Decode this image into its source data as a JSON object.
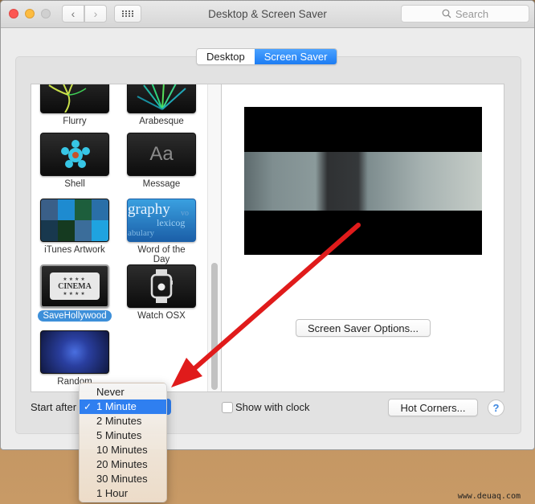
{
  "window": {
    "title": "Desktop & Screen Saver",
    "search_placeholder": "Search"
  },
  "tabs": [
    {
      "label": "Desktop",
      "active": false
    },
    {
      "label": "Screen Saver",
      "active": true
    }
  ],
  "savers": [
    {
      "label": "Flurry",
      "icon": "flurry-thumbnail"
    },
    {
      "label": "Arabesque",
      "icon": "arabesque-thumbnail"
    },
    {
      "label": "Shell",
      "icon": "shell-thumbnail"
    },
    {
      "label": "Message",
      "icon": "message-thumbnail",
      "glyph": "Aa"
    },
    {
      "label": "iTunes Artwork",
      "icon": "itunes-artwork-thumbnail"
    },
    {
      "label": "Word of the Day",
      "icon": "word-of-the-day-thumbnail",
      "words": [
        "graphy",
        "lexicog",
        "abulary",
        "vo"
      ]
    },
    {
      "label": "SaveHollywood",
      "icon": "cinema-ticket-thumbnail",
      "glyph": "CINEMA",
      "selected": true
    },
    {
      "label": "Watch OSX",
      "icon": "apple-watch-thumbnail"
    },
    {
      "label": "Random",
      "icon": "random-swirl-thumbnail"
    }
  ],
  "preview": {
    "description": "video preview of person beside car"
  },
  "buttons": {
    "options": "Screen Saver Options...",
    "hot_corners": "Hot Corners...",
    "help": "?"
  },
  "start_after": {
    "label": "Start after",
    "selected": "1 Minute",
    "options": [
      "Never",
      "1 Minute",
      "2 Minutes",
      "5 Minutes",
      "10 Minutes",
      "20 Minutes",
      "30 Minutes",
      "1 Hour"
    ]
  },
  "show_with_clock": {
    "label": "Show with clock",
    "checked": false
  },
  "watermark": "www.deuaq.com",
  "colors": {
    "accent": "#2f7ff0",
    "annotation_arrow": "#e01b1b"
  }
}
